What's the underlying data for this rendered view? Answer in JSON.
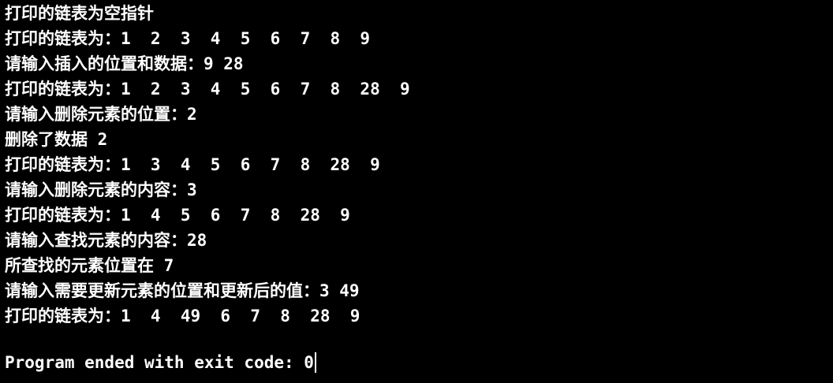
{
  "console": {
    "lines": [
      "打印的链表为空指针",
      "打印的链表为：1  2  3  4  5  6  7  8  9",
      "请输入插入的位置和数据：9 28",
      "打印的链表为：1  2  3  4  5  6  7  8  28  9",
      "请输入删除元素的位置：2",
      "删除了数据 2",
      "打印的链表为：1  3  4  5  6  7  8  28  9",
      "请输入删除元素的内容：3",
      "打印的链表为：1  4  5  6  7  8  28  9",
      "请输入查找元素的内容：28",
      "所查找的元素位置在 7",
      "请输入需要更新元素的位置和更新后的值：3 49",
      "打印的链表为：1  4  49  6  7  8  28  9"
    ],
    "exit_message": "Program ended with exit code: 0"
  },
  "colors": {
    "background": "#000000",
    "text": "#ffffff"
  }
}
